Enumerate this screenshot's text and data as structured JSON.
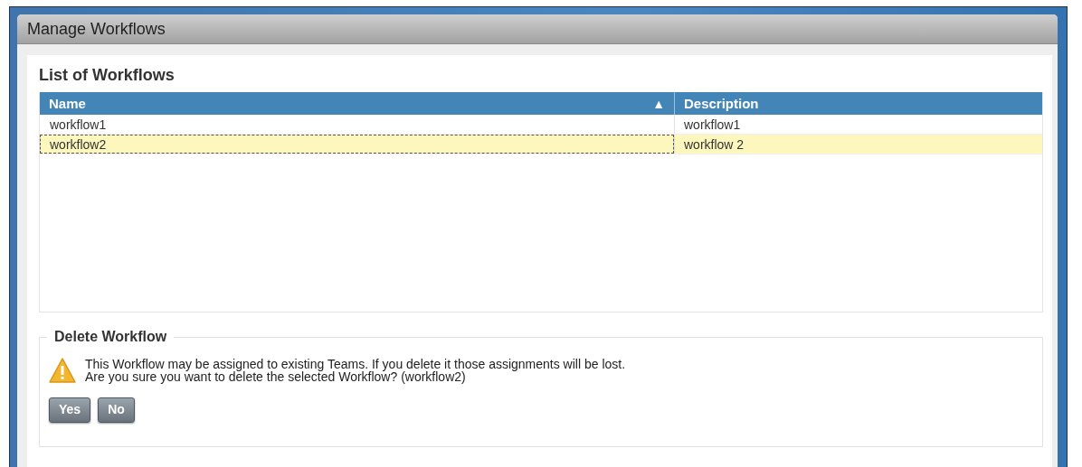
{
  "window": {
    "title": "Manage Workflows"
  },
  "list": {
    "heading": "List of Workflows",
    "columns": [
      {
        "label": "Name",
        "sorted": true,
        "sort_icon": "▲"
      },
      {
        "label": "Description"
      }
    ],
    "rows": [
      {
        "cells": [
          "workflow1",
          "workflow1"
        ],
        "selected": false
      },
      {
        "cells": [
          "workflow2",
          "workflow 2"
        ],
        "selected": true
      }
    ]
  },
  "delete": {
    "legend": "Delete Workflow",
    "message": [
      "This Workflow may be assigned to existing Teams. If you delete it those assignments will be lost.",
      "Are you sure you want to delete the selected Workflow? (workflow2)"
    ],
    "buttons": [
      "Yes",
      "No"
    ]
  }
}
